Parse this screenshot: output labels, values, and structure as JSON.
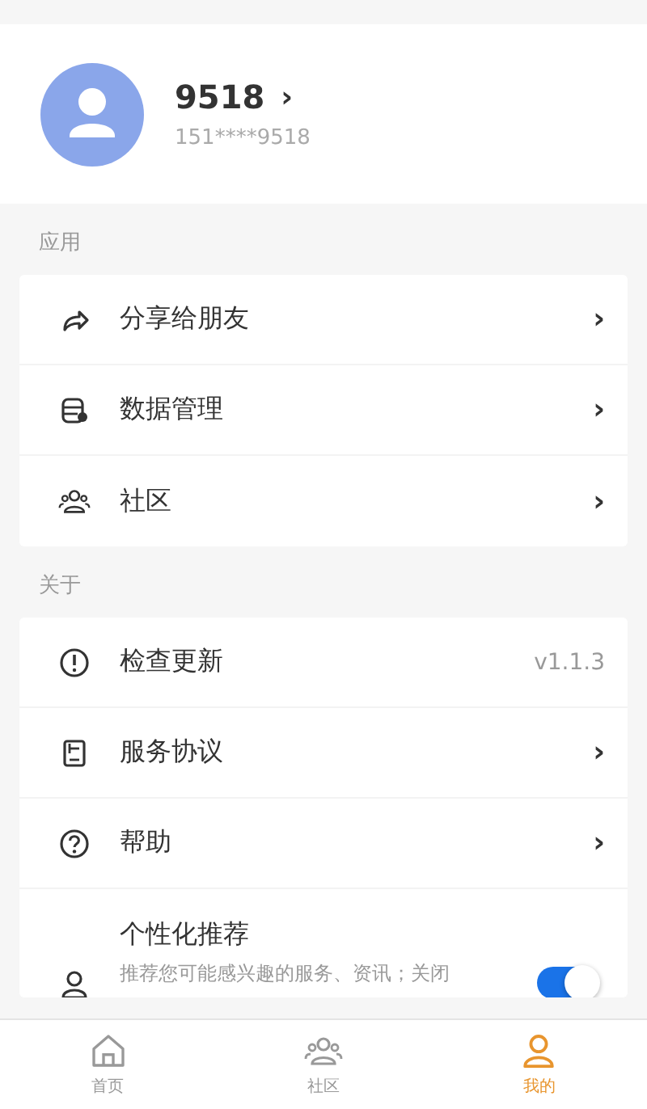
{
  "profile": {
    "name": "9518",
    "chevron": "›",
    "phone": "151****9518"
  },
  "sections": [
    {
      "title": "应用",
      "items": [
        {
          "label": "分享给朋友",
          "kind": "link",
          "chevron": "›"
        },
        {
          "label": "数据管理",
          "kind": "link",
          "chevron": "›"
        },
        {
          "label": "社区",
          "kind": "link",
          "chevron": "›"
        }
      ]
    },
    {
      "title": "关于",
      "items": [
        {
          "label": "检查更新",
          "kind": "value",
          "value": "v1.1.3"
        },
        {
          "label": "服务协议",
          "kind": "link",
          "chevron": "›"
        },
        {
          "label": "帮助",
          "kind": "link",
          "chevron": "›"
        },
        {
          "label": "个性化推荐",
          "kind": "toggle",
          "description": "推荐您可能感兴趣的服务、资讯；关闭",
          "on": true
        }
      ]
    }
  ],
  "tabs": [
    {
      "label": "首页",
      "selected": false
    },
    {
      "label": "社区",
      "selected": false
    },
    {
      "label": "我的",
      "selected": true
    }
  ]
}
